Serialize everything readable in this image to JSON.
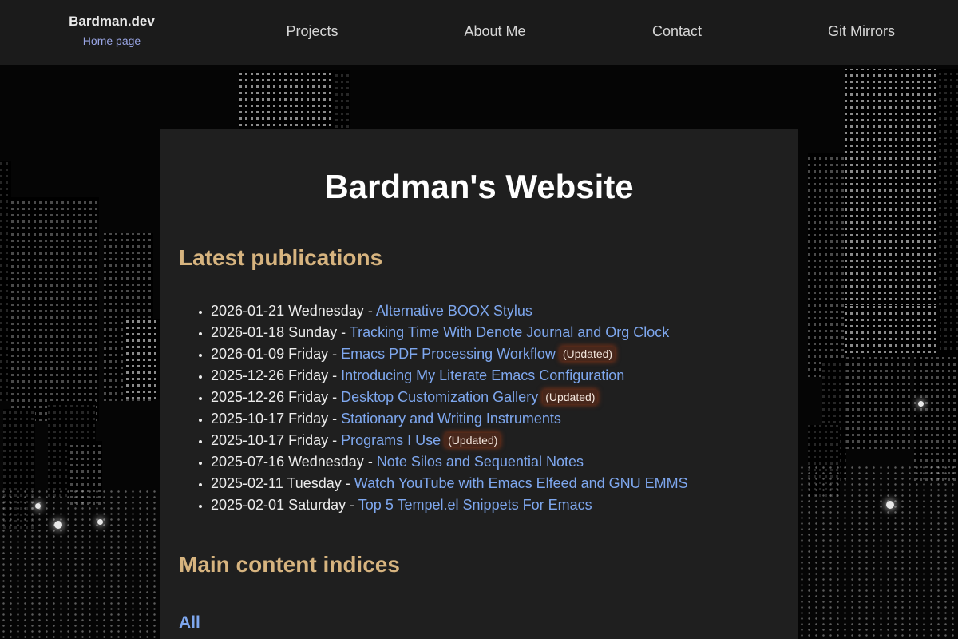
{
  "colors": {
    "topbar_bg": "#1b1b1b",
    "panel_bg": "#1f1f1f",
    "heading_accent": "#d7b47f",
    "link": "#7ea7ee",
    "brand_sub": "#9aa6e6",
    "updated_badge_glow": "#aa3c14"
  },
  "header": {
    "brand": "Bardman.dev",
    "brand_sub": "Home page",
    "nav": [
      {
        "label": "Projects"
      },
      {
        "label": "About Me"
      },
      {
        "label": "Contact"
      },
      {
        "label": "Git Mirrors"
      }
    ]
  },
  "main": {
    "title": "Bardman's Website",
    "latest_heading": "Latest publications",
    "publications": [
      {
        "date": "2026-01-21 Wednesday",
        "sep": " - ",
        "title": "Alternative BOOX Stylus",
        "badge": ""
      },
      {
        "date": "2026-01-18 Sunday",
        "sep": " - ",
        "title": "Tracking Time With Denote Journal and Org Clock",
        "badge": ""
      },
      {
        "date": "2026-01-09 Friday",
        "sep": " - ",
        "title": "Emacs PDF Processing Workflow",
        "badge": "(Updated)"
      },
      {
        "date": "2025-12-26 Friday",
        "sep": " - ",
        "title": "Introducing My Literate Emacs Configuration",
        "badge": ""
      },
      {
        "date": "2025-12-26 Friday",
        "sep": " - ",
        "title": "Desktop Customization Gallery",
        "badge": "(Updated)"
      },
      {
        "date": "2025-10-17 Friday",
        "sep": " - ",
        "title": "Stationary and Writing Instruments",
        "badge": ""
      },
      {
        "date": "2025-10-17 Friday",
        "sep": " - ",
        "title": "Programs I Use",
        "badge": "(Updated)"
      },
      {
        "date": "2025-07-16 Wednesday",
        "sep": " - ",
        "title": "Note Silos and Sequential Notes",
        "badge": ""
      },
      {
        "date": "2025-02-11 Tuesday",
        "sep": " - ",
        "title": "Watch YouTube with Emacs Elfeed and GNU EMMS",
        "badge": ""
      },
      {
        "date": "2025-02-01 Saturday",
        "sep": " - ",
        "title": "Top 5 Tempel.el Snippets For Emacs",
        "badge": ""
      }
    ],
    "indices_heading": "Main content indices",
    "indices_all": "All"
  }
}
